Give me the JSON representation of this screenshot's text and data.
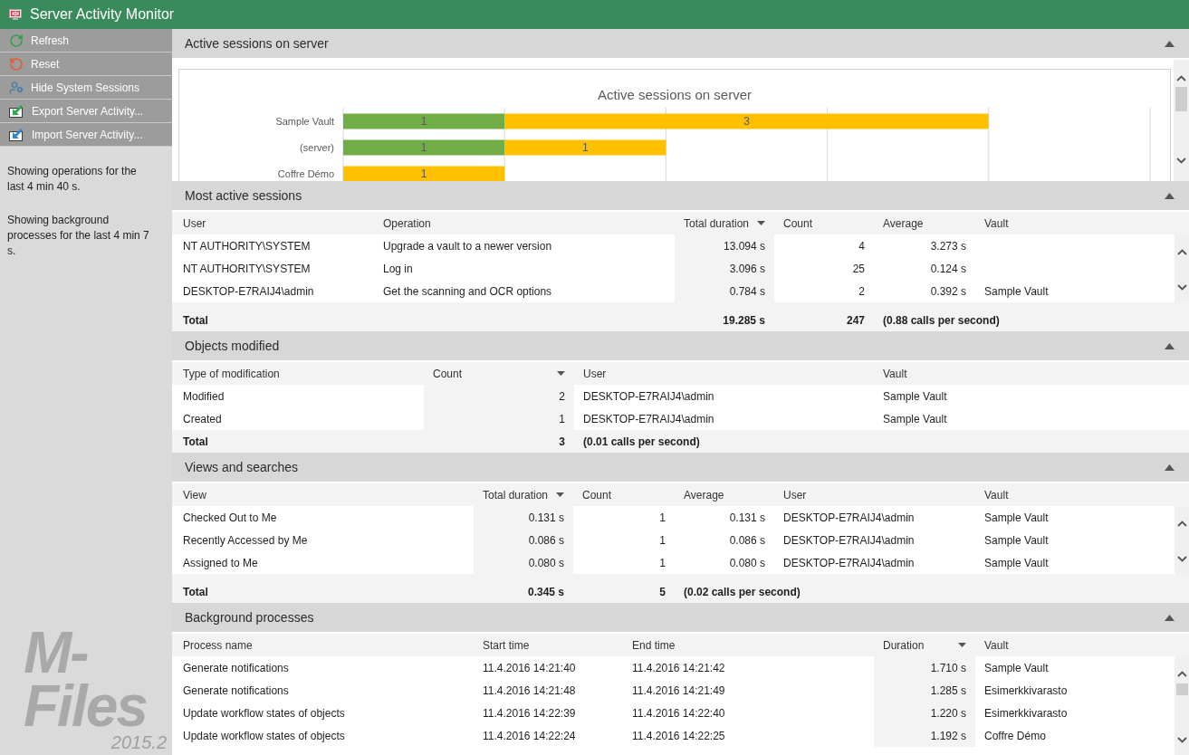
{
  "window": {
    "title": "Server Activity Monitor"
  },
  "sidebar": {
    "buttons": [
      {
        "label": "Refresh",
        "kind": "refresh"
      },
      {
        "label": "Reset",
        "kind": "reset"
      },
      {
        "label": "Hide System Sessions",
        "kind": "hide-system"
      },
      {
        "label": "Export Server Activity...",
        "kind": "export"
      },
      {
        "label": "Import Server Activity...",
        "kind": "import"
      }
    ],
    "notes": [
      "Showing operations for the last 4 min 40 s.",
      "Showing background processes for the last 4 min 7 s."
    ],
    "logo": {
      "name": "M-Files",
      "version": "2015.2"
    }
  },
  "sections": [
    {
      "title": "Active sessions on server",
      "kind": "chart",
      "expanded": true,
      "scrollbar": {
        "thumb": true
      },
      "chart_data": {
        "type": "bar",
        "orientation": "horizontal",
        "stacked": true,
        "title": "Active sessions on server",
        "categories": [
          "Sample Vault",
          "(server)",
          "Coffre Démo"
        ],
        "series": [
          {
            "color": "#70ad47",
            "values": [
              1,
              1,
              null
            ]
          },
          {
            "color": "#ffc000",
            "values": [
              3,
              1,
              1
            ]
          }
        ],
        "xlim": [
          0,
          5
        ],
        "data_labels": true
      }
    },
    {
      "title": "Most active sessions",
      "kind": "table",
      "expanded": true,
      "scrollbar": {
        "thumb": false
      },
      "columns": [
        {
          "label": "User",
          "sorted": false
        },
        {
          "label": "Operation",
          "sorted": false
        },
        {
          "label": "Total duration",
          "sorted": true
        },
        {
          "label": "Count",
          "sorted": false
        },
        {
          "label": "Average",
          "sorted": false
        },
        {
          "label": "Vault",
          "sorted": false
        }
      ],
      "rows": [
        [
          "NT AUTHORITY\\SYSTEM",
          "Upgrade a vault to a newer version",
          "13.094 s",
          "4",
          "3.273 s"
        ],
        [
          "NT AUTHORITY\\SYSTEM",
          "Log in",
          "3.096 s",
          "25",
          "0.124 s"
        ],
        [
          "DESKTOP-E7RAIJ4\\admin",
          "Get the scanning and OCR options",
          "0.784 s",
          "2",
          "0.392 s",
          "Sample Vault"
        ]
      ],
      "total": [
        "Total",
        "19.285 s",
        "247",
        "(0.88 calls per second)"
      ]
    },
    {
      "title": "Objects modified",
      "kind": "table",
      "expanded": true,
      "columns": [
        {
          "label": "Type of modification",
          "sorted": false
        },
        {
          "label": "Count",
          "sorted": true
        },
        {
          "label": "User",
          "sorted": false
        },
        {
          "label": "Vault",
          "sorted": false
        }
      ],
      "rows": [
        [
          "Modified",
          "2",
          "DESKTOP-E7RAIJ4\\admin",
          "Sample Vault"
        ],
        [
          "Created",
          "1",
          "DESKTOP-E7RAIJ4\\admin",
          "Sample Vault"
        ]
      ],
      "total": [
        "Total",
        "3",
        "(0.01 calls per second)"
      ]
    },
    {
      "title": "Views and searches",
      "kind": "table",
      "expanded": true,
      "scrollbar": {
        "thumb": false
      },
      "columns": [
        {
          "label": "View",
          "sorted": false
        },
        {
          "label": "Total duration",
          "sorted": true
        },
        {
          "label": "Count",
          "sorted": false
        },
        {
          "label": "Average",
          "sorted": false
        },
        {
          "label": "User",
          "sorted": false
        },
        {
          "label": "Vault",
          "sorted": false
        }
      ],
      "rows": [
        [
          "Checked Out to Me",
          "0.131 s",
          "1",
          "0.131 s",
          "DESKTOP-E7RAIJ4\\admin",
          "Sample Vault"
        ],
        [
          "Recently Accessed by Me",
          "0.086 s",
          "1",
          "0.086 s",
          "DESKTOP-E7RAIJ4\\admin",
          "Sample Vault"
        ],
        [
          "Assigned to Me",
          "0.080 s",
          "1",
          "0.080 s",
          "DESKTOP-E7RAIJ4\\admin",
          "Sample Vault"
        ]
      ],
      "total": [
        "Total",
        "0.345 s",
        "5",
        "(0.02 calls per second)"
      ]
    },
    {
      "title": "Background processes",
      "kind": "table",
      "expanded": true,
      "scrollbar": {
        "thumb": true
      },
      "columns": [
        {
          "label": "Process name",
          "sorted": false
        },
        {
          "label": "Start time",
          "sorted": false
        },
        {
          "label": "End time",
          "sorted": false
        },
        {
          "label": "Duration",
          "sorted": true
        },
        {
          "label": "Vault",
          "sorted": false
        }
      ],
      "rows": [
        [
          "Generate notifications",
          "11.4.2016 14:21:40",
          "11.4.2016 14:21:42",
          "1.710 s",
          "Sample Vault"
        ],
        [
          "Generate notifications",
          "11.4.2016 14:21:48",
          "11.4.2016 14:21:49",
          "1.285 s",
          "Esimerkkivarasto"
        ],
        [
          "Update workflow states of objects",
          "11.4.2016 14:22:39",
          "11.4.2016 14:22:40",
          "1.220 s",
          "Esimerkkivarasto"
        ],
        [
          "Update workflow states of objects",
          "11.4.2016 14:22:24",
          "11.4.2016 14:22:25",
          "1.192 s",
          "Coffre Démo"
        ]
      ]
    }
  ]
}
